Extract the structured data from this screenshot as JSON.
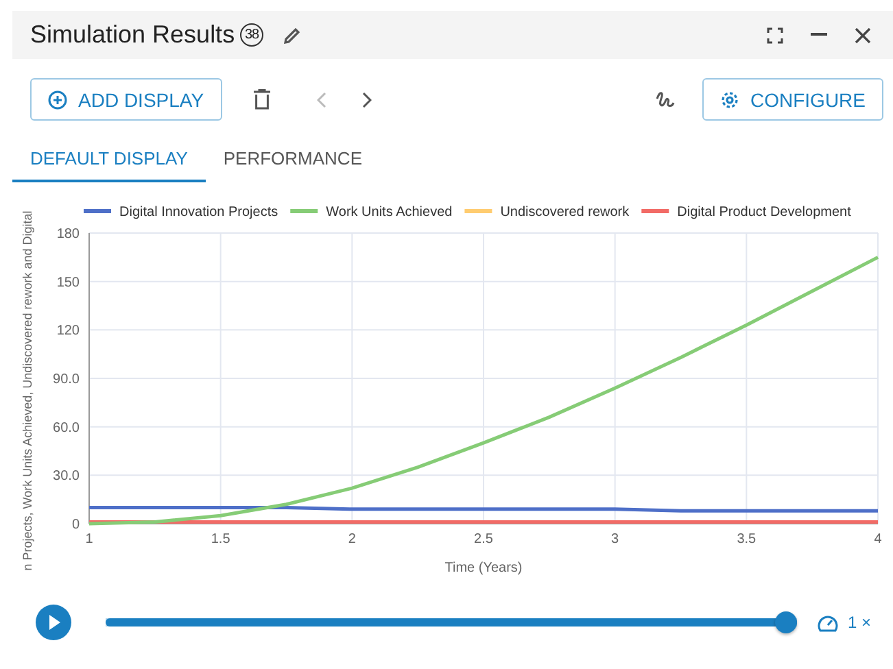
{
  "window": {
    "title": "Simulation Results",
    "badge": "38"
  },
  "toolbar": {
    "add_button": "ADD DISPLAY",
    "prev_disabled": true,
    "next_disabled": false,
    "configure_button": "CONFIGURE"
  },
  "tabs": [
    {
      "label": "DEFAULT DISPLAY",
      "selected": true
    },
    {
      "label": "PERFORMANCE",
      "selected": false
    }
  ],
  "chart_data": {
    "type": "line",
    "xlabel": "Time (Years)",
    "ylabel": "n Projects, Work Units Achieved, Undiscovered rework and Digital",
    "x": [
      1,
      1.25,
      1.5,
      1.75,
      2,
      2.25,
      2.5,
      2.75,
      3,
      3.25,
      3.5,
      3.75,
      4
    ],
    "series": [
      {
        "name": "Digital Innovation Projects",
        "color": "#4e6fc8",
        "values": [
          10,
          10,
          10,
          10,
          9,
          9,
          9,
          9,
          9,
          8,
          8,
          8,
          8
        ]
      },
      {
        "name": "Work Units Achieved",
        "color": "#86cc76",
        "values": [
          0,
          1,
          5,
          12,
          22,
          35,
          50,
          66,
          84,
          103,
          123,
          144,
          165
        ]
      },
      {
        "name": "Undiscovered rework",
        "color": "#ffcc70",
        "values": [
          null,
          null,
          null,
          null,
          null,
          null,
          null,
          null,
          null,
          null,
          null,
          null,
          null
        ]
      },
      {
        "name": "Digital Product Development",
        "color": "#f26b66",
        "values": [
          1,
          1,
          1,
          1,
          1,
          1,
          1,
          1,
          1,
          1,
          1,
          1,
          1
        ]
      }
    ],
    "grid": true,
    "legend": true,
    "xlim": [
      1,
      4
    ],
    "ylim": [
      0,
      180
    ],
    "xticks": [
      1,
      1.5,
      2,
      2.5,
      3,
      3.5,
      4
    ],
    "yticks": [
      0,
      {
        "value": 30,
        "label": "30.0"
      },
      {
        "value": 60,
        "label": "60.0"
      },
      {
        "value": 90,
        "label": "90.0"
      },
      120,
      150,
      180
    ]
  },
  "player": {
    "level": 1,
    "speed": "1 ×"
  }
}
